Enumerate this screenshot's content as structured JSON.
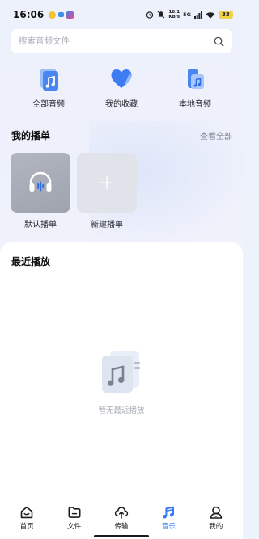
{
  "status_bar": {
    "time": "16:06",
    "net_speed_value": "16.1",
    "net_speed_unit": "KB/s",
    "network": "5G",
    "battery": "33"
  },
  "search": {
    "placeholder": "搜索音频文件"
  },
  "quick_entries": [
    {
      "label": "全部音频",
      "icon": "music-file-icon"
    },
    {
      "label": "我的收藏",
      "icon": "heart-icon"
    },
    {
      "label": "本地音频",
      "icon": "phone-music-icon"
    }
  ],
  "playlists_section": {
    "title": "我的播单",
    "view_all": "查看全部",
    "items": [
      {
        "label": "默认播单",
        "icon": "headphones-icon"
      },
      {
        "label": "新建播单",
        "icon": "plus-icon"
      }
    ]
  },
  "recent": {
    "title": "最近播放",
    "empty_text": "暂无最近播放"
  },
  "tab_bar": {
    "active": "音乐",
    "tabs": [
      {
        "label": "首页",
        "icon": "home-icon"
      },
      {
        "label": "文件",
        "icon": "folder-icon"
      },
      {
        "label": "传输",
        "icon": "cloud-transfer-icon"
      },
      {
        "label": "音乐",
        "icon": "music-note-icon"
      },
      {
        "label": "我的",
        "icon": "profile-icon"
      }
    ]
  },
  "colors": {
    "accent": "#3a7bf4",
    "background": "#eef2fb",
    "panel": "#ffffff"
  }
}
